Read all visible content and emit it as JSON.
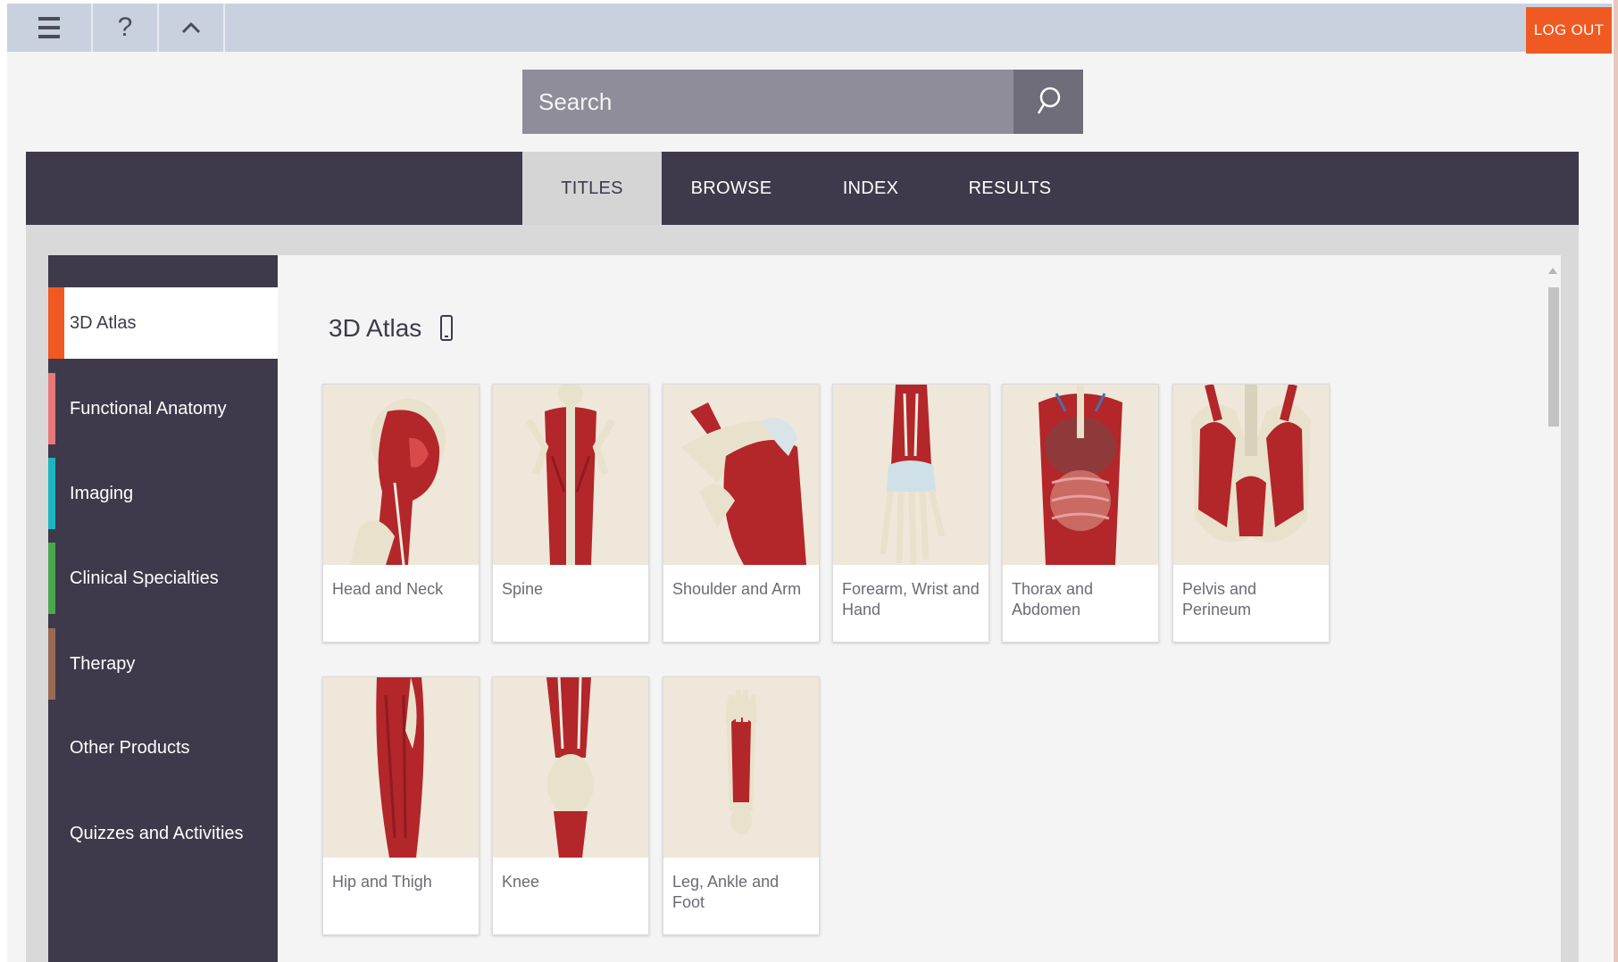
{
  "topbar": {
    "menu_icon": "hamburger-menu-icon",
    "help_icon": "question-mark-icon",
    "collapse_icon": "chevron-up-icon",
    "help_glyph": "?",
    "logout_label": "LOG OUT"
  },
  "search": {
    "placeholder": "Search",
    "value": "",
    "button_icon": "search-icon"
  },
  "tabs": [
    {
      "label": "TITLES",
      "active": true
    },
    {
      "label": "BROWSE",
      "active": false
    },
    {
      "label": "INDEX",
      "active": false
    },
    {
      "label": "RESULTS",
      "active": false
    }
  ],
  "sidebar": {
    "items": [
      {
        "label": "3D Atlas",
        "color": "#f05a22",
        "active": true
      },
      {
        "label": "Functional Anatomy",
        "color": "#e8777a",
        "active": false
      },
      {
        "label": "Imaging",
        "color": "#1ab5c1",
        "active": false
      },
      {
        "label": "Clinical Specialties",
        "color": "#4aa84a",
        "active": false
      },
      {
        "label": "Therapy",
        "color": "#9a6a55",
        "active": false
      },
      {
        "label": "Other Products",
        "color": "",
        "active": false
      },
      {
        "label": "Quizzes and Activities",
        "color": "",
        "active": false
      }
    ]
  },
  "main": {
    "section_title": "3D Atlas",
    "device_icon": "mobile-device-icon",
    "cards": [
      {
        "label": "Head and Neck"
      },
      {
        "label": "Spine"
      },
      {
        "label": "Shoulder and Arm"
      },
      {
        "label": "Forearm, Wrist and Hand"
      },
      {
        "label": "Thorax and Abdomen"
      },
      {
        "label": "Pelvis and Perineum"
      },
      {
        "label": "Hip and Thigh"
      },
      {
        "label": "Knee"
      },
      {
        "label": "Leg, Ankle and Foot"
      }
    ]
  },
  "colors": {
    "brand_dark": "#3e3a4b",
    "accent_orange": "#f05a22",
    "topbar": "#c9d1de",
    "muscle_red": "#b3262a",
    "bone": "#e8e2cc"
  }
}
